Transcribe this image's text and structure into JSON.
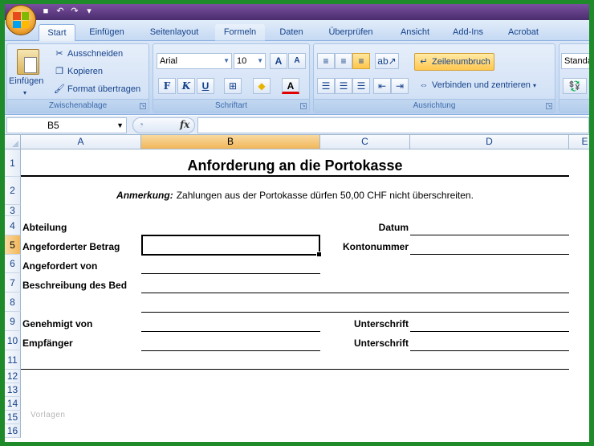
{
  "quick_access": {
    "icons": [
      "save-icon",
      "undo-icon",
      "redo-icon",
      "customize-icon"
    ]
  },
  "tabs": [
    {
      "label": "Start",
      "active": true
    },
    {
      "label": "Einfügen"
    },
    {
      "label": "Seitenlayout"
    },
    {
      "label": "Formeln"
    },
    {
      "label": "Daten"
    },
    {
      "label": "Überprüfen"
    },
    {
      "label": "Ansicht"
    },
    {
      "label": "Add-Ins"
    },
    {
      "label": "Acrobat"
    }
  ],
  "ribbon": {
    "clipboard": {
      "paste_label": "Einfügen",
      "cut_label": "Ausschneiden",
      "copy_label": "Kopieren",
      "format_painter_label": "Format übertragen",
      "group_label": "Zwischenablage"
    },
    "font": {
      "font_name": "Arial",
      "font_size": "10",
      "grow_label": "A",
      "shrink_label": "A",
      "bold_label": "F",
      "italic_label": "K",
      "underline_label": "U",
      "font_color_label": "A",
      "group_label": "Schriftart"
    },
    "alignment": {
      "wrap_label": "Zeilenumbruch",
      "merge_label": "Verbinden und zentrieren",
      "group_label": "Ausrichtung"
    },
    "number": {
      "format_label": "Standar"
    }
  },
  "formula_bar": {
    "name_box": "B5",
    "fx_label": "fx",
    "formula": ""
  },
  "columns": [
    "A",
    "B",
    "C",
    "D",
    "E"
  ],
  "rows": [
    "1",
    "2",
    "3",
    "4",
    "5",
    "6",
    "7",
    "8",
    "9",
    "10",
    "11",
    "12",
    "13",
    "14",
    "15",
    "16"
  ],
  "sheet": {
    "title": "Anforderung an die Portokasse",
    "note_label": "Anmerkung:",
    "note_text": "Zahlungen aus der Portokasse dürfen 50,00 CHF nicht überschreiten.",
    "abteilung": "Abteilung",
    "datum": "Datum",
    "betrag": "Angeforderter Betrag",
    "kontonummer": "Kontonummer",
    "angefordert_von": "Angefordert von",
    "beschreibung": "Beschreibung des Bed",
    "genehmigt_von": "Genehmigt von",
    "unterschrift1": "Unterschrift",
    "empfaenger": "Empfänger",
    "unterschrift2": "Unterschrift"
  },
  "watermark": "Vorlagen"
}
